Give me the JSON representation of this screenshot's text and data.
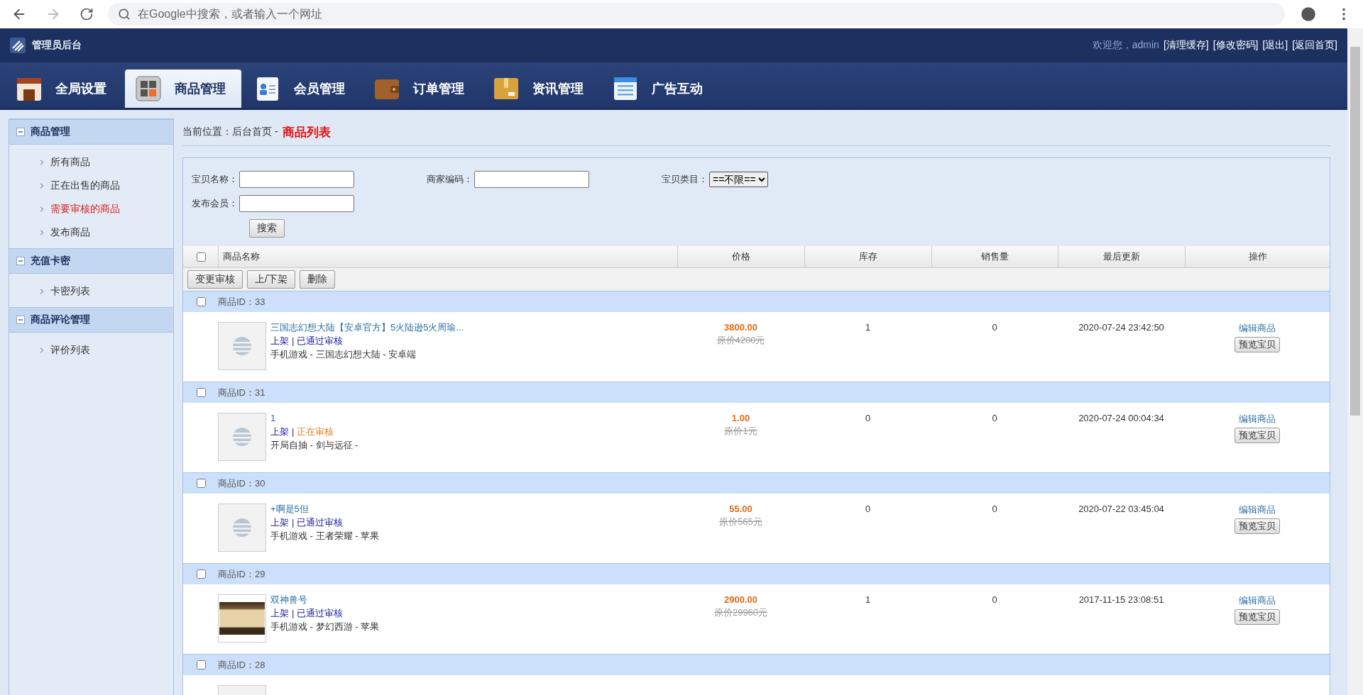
{
  "browser": {
    "address_placeholder": "在Google中搜索，或者输入一个网址"
  },
  "header": {
    "title": "管理员后台",
    "welcome": "欢迎您，admin",
    "links": [
      "[清理缓存]",
      "[修改密码]",
      "[退出]",
      "[返回首页]"
    ]
  },
  "nav": [
    {
      "label": "全局设置",
      "selected": false
    },
    {
      "label": "商品管理",
      "selected": true
    },
    {
      "label": "会员管理",
      "selected": false
    },
    {
      "label": "订单管理",
      "selected": false
    },
    {
      "label": "资讯管理",
      "selected": false
    },
    {
      "label": "广告互动",
      "selected": false
    }
  ],
  "sidebar": [
    {
      "title": "商品管理",
      "expanded": true,
      "items": [
        {
          "label": "所有商品",
          "selected": false
        },
        {
          "label": "正在出售的商品",
          "selected": false
        },
        {
          "label": "需要审核的商品",
          "selected": true
        },
        {
          "label": "发布商品",
          "selected": false
        }
      ]
    },
    {
      "title": "充值卡密",
      "expanded": true,
      "items": [
        {
          "label": "卡密列表",
          "selected": false
        }
      ]
    },
    {
      "title": "商品评论管理",
      "expanded": true,
      "items": [
        {
          "label": "评价列表",
          "selected": false
        }
      ]
    }
  ],
  "breadcrumb": {
    "path": "当前位置：后台首页 -",
    "current": "商品列表"
  },
  "search": {
    "fields": [
      {
        "label": "宝贝名称：",
        "kind": "text"
      },
      {
        "label": "商家编码：",
        "kind": "text"
      },
      {
        "label": "宝贝类目：",
        "kind": "select",
        "value": "==不限=="
      },
      {
        "label": "发布会员：",
        "kind": "text"
      }
    ],
    "button": "搜索"
  },
  "table": {
    "all_checked": false,
    "columns": [
      "商品名称",
      "价格",
      "库存",
      "销售量",
      "最后更新",
      "操作"
    ],
    "bulk_actions": [
      "变更审核",
      "上/下架",
      "删除"
    ]
  },
  "products": [
    {
      "id_label": "商品ID：33",
      "checked": false,
      "thumbnail": {
        "kind": "placeholder"
      },
      "title": "三国志幻想大陆【安卓官方】5火陆逊5火周瑜...",
      "shelf": "上架",
      "divider": "|",
      "status": {
        "label": "已通过审核",
        "kind": "approved"
      },
      "category": "手机游戏 - 三国志幻想大陆 - 安卓端",
      "price": "3800.00",
      "original_price": "原价4200元",
      "stock": "1",
      "sales": "0",
      "updated": "2020-07-24 23:42:50",
      "edit": "编辑商品",
      "preview": "预览宝贝"
    },
    {
      "id_label": "商品ID：31",
      "checked": false,
      "thumbnail": {
        "kind": "placeholder"
      },
      "title": "1",
      "shelf": "上架",
      "divider": "|",
      "status": {
        "label": "正在审核",
        "kind": "pending"
      },
      "category": "开局自抽 - 剑与远征 -",
      "price": "1.00",
      "original_price": "原价1元",
      "stock": "0",
      "sales": "0",
      "updated": "2020-07-24 00:04:34",
      "edit": "编辑商品",
      "preview": "预览宝贝"
    },
    {
      "id_label": "商品ID：30",
      "checked": false,
      "thumbnail": {
        "kind": "placeholder"
      },
      "title": "+啊是5但",
      "shelf": "上架",
      "divider": "|",
      "status": {
        "label": "已通过审核",
        "kind": "approved"
      },
      "category": "手机游戏 - 王者荣耀 - 苹果",
      "price": "55.00",
      "original_price": "原价565元",
      "stock": "0",
      "sales": "0",
      "updated": "2020-07-22 03:45:04",
      "edit": "编辑商品",
      "preview": "预览宝贝"
    },
    {
      "id_label": "商品ID：29",
      "checked": false,
      "thumbnail": {
        "kind": "photo"
      },
      "title": "双神兽号",
      "shelf": "上架",
      "divider": "|",
      "status": {
        "label": "已通过审核",
        "kind": "approved"
      },
      "category": "手机游戏 - 梦幻西游 - 苹果",
      "price": "2900.00",
      "original_price": "原价29960元",
      "stock": "1",
      "sales": "0",
      "updated": "2017-11-15 23:08:51",
      "edit": "编辑商品",
      "preview": "预览宝贝"
    },
    {
      "id_label": "商品ID：28",
      "checked": false,
      "thumbnail": {
        "kind": "placeholder"
      }
    }
  ]
}
